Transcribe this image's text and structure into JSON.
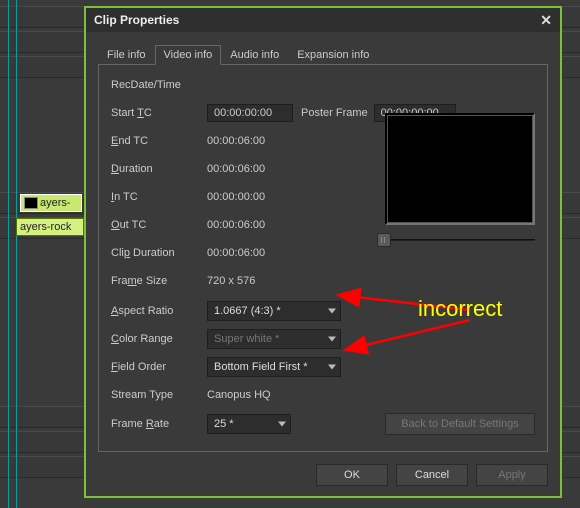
{
  "dialog": {
    "title": "Clip Properties",
    "tabs": [
      "File info",
      "Video info",
      "Audio info",
      "Expansion info"
    ],
    "active_tab": 1,
    "labels": {
      "recdate": "RecDate/Time",
      "start_tc": "Start TC",
      "poster": "Poster Frame",
      "end_tc": "End TC",
      "duration": "Duration",
      "in_tc": "In TC",
      "out_tc": "Out TC",
      "clip_duration": "Clip Duration",
      "frame_size": "Frame Size",
      "aspect": "Aspect Ratio",
      "color_range": "Color Range",
      "field_order": "Field Order",
      "stream_type": "Stream Type",
      "frame_rate": "Frame Rate"
    },
    "values": {
      "start_tc": "00:00:00:00",
      "poster": "00:00:00:00",
      "end_tc": "00:00:06:00",
      "duration": "00:00:06:00",
      "in_tc": "00:00:00:00",
      "out_tc": "00:00:06:00",
      "clip_duration": "00:00:06:00",
      "frame_size": "720 x 576",
      "aspect": "1.0667 (4:3) *",
      "color_range": "Super white *",
      "field_order": "Bottom Field First *",
      "stream_type": "Canopus HQ",
      "frame_rate": "25 *"
    },
    "buttons": {
      "defaults": "Back to Default Settings",
      "ok": "OK",
      "cancel": "Cancel",
      "apply": "Apply"
    }
  },
  "timeline": {
    "clips": [
      {
        "label": "ayers-"
      },
      {
        "label": "ayers-rock"
      }
    ]
  },
  "annotation": {
    "text": "incorrect"
  }
}
